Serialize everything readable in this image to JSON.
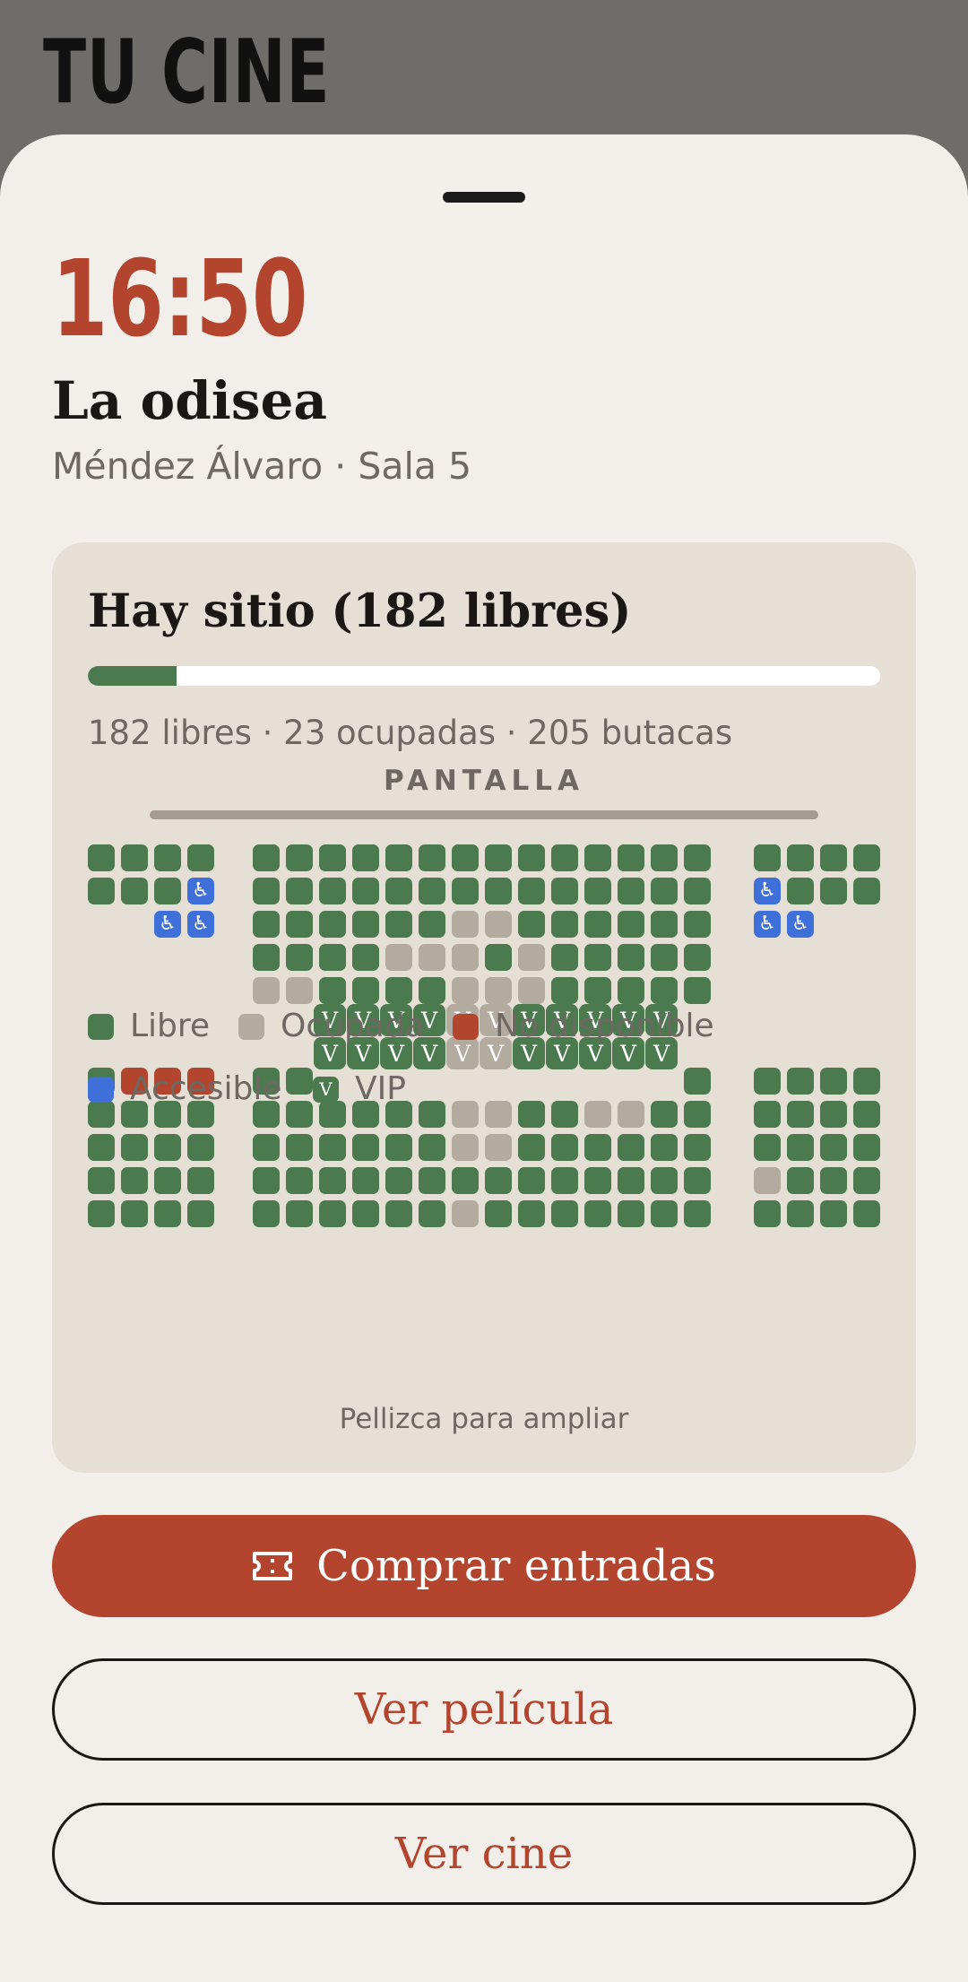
{
  "brand": "TU CINE",
  "showtime": {
    "time": "16:50",
    "movie": "La odisea",
    "venue": "Méndez Álvaro · Sala 5"
  },
  "availability": {
    "title": "Hay sitio (182 libres)",
    "counts": "182 libres · 23 ocupadas · 205 butacas",
    "occupied_fraction": 0.112
  },
  "seatmap": {
    "screen_label": "PANTALLA",
    "hint": "Pellizca para ampliar",
    "vip_mark": "V",
    "accessible_mark": "♿"
  },
  "legend": {
    "free": "Libre",
    "occupied": "Ocupada",
    "unavailable": "No disponible",
    "accessible": "Accesible",
    "vip": "VIP"
  },
  "actions": {
    "buy": "Comprar entradas",
    "movie": "Ver película",
    "cinema": "Ver cine"
  },
  "colors": {
    "accent": "#b3442d",
    "free": "#4a7a4e",
    "occupied": "#b3aaa0",
    "unavailable": "#b3442d",
    "accessible": "#3f6fd9"
  }
}
